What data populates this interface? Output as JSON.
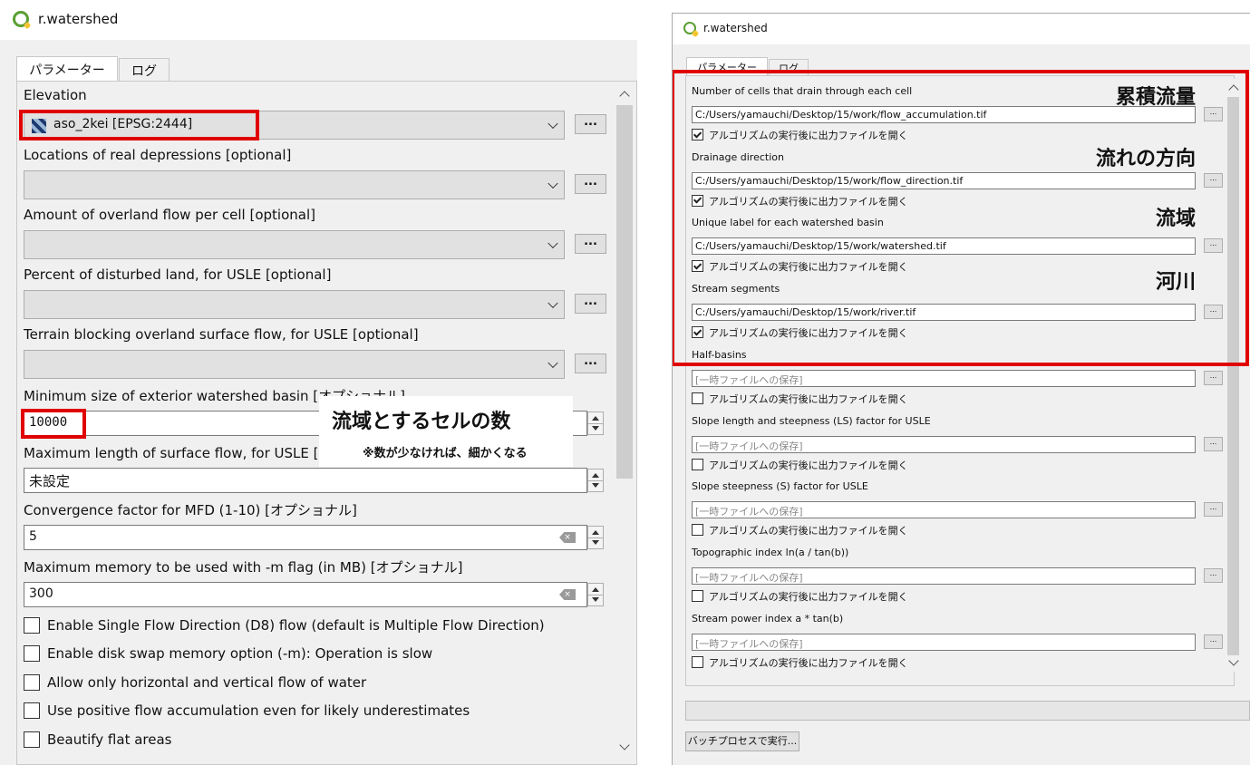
{
  "left": {
    "title": "r.watershed",
    "tabs": [
      "パラメーター",
      "ログ"
    ],
    "elevation_label": "Elevation",
    "elevation_value": "aso_2kei [EPSG:2444]",
    "depressions_label": "Locations of real depressions [optional]",
    "overland_label": "Amount of overland flow per cell [optional]",
    "disturbed_label": "Percent of disturbed land, for USLE [optional]",
    "blocking_label": "Terrain blocking overland surface flow, for USLE [optional]",
    "min_size_label": "Minimum size of exterior watershed basin [オプショナル]",
    "min_size_value": "10000",
    "max_length_label": "Maximum length of surface flow, for USLE [オプショ",
    "max_length_value": "未設定",
    "convergence_label": "Convergence factor for MFD (1-10) [オプショナル]",
    "convergence_value": "5",
    "memory_label": "Maximum memory to be used with -m flag (in MB) [オプショナル]",
    "memory_value": "300",
    "checkboxes": [
      "Enable Single Flow Direction (D8) flow (default is Multiple Flow Direction)",
      "Enable disk swap memory option (-m): Operation is slow",
      "Allow only horizontal and vertical flow of water",
      "Use positive flow accumulation even for likely underestimates",
      "Beautify flat areas"
    ],
    "ellipsis": "...",
    "annotation_title": "流域とするセルの数",
    "annotation_sub": "※数が少なければ、細かくなる"
  },
  "right": {
    "title": "r.watershed",
    "tabs": [
      "パラメーター",
      "ログ"
    ],
    "open_label": "アルゴリズムの実行後に出力ファイルを開く",
    "temp_placeholder": "[一時ファイルへの保存]",
    "ellipsis": "...",
    "outputs": [
      {
        "label": "Number of cells that drain through each cell",
        "value": "C:/Users/yamauchi/Desktop/15/work/flow_accumulation.tif",
        "checked": true,
        "note": "累積流量"
      },
      {
        "label": "Drainage direction",
        "value": "C:/Users/yamauchi/Desktop/15/work/flow_direction.tif",
        "checked": true,
        "note": "流れの方向"
      },
      {
        "label": "Unique label for each watershed basin",
        "value": "C:/Users/yamauchi/Desktop/15/work/watershed.tif",
        "checked": true,
        "note": "流域"
      },
      {
        "label": "Stream segments",
        "value": "C:/Users/yamauchi/Desktop/15/work/river.tif",
        "checked": true,
        "note": "河川"
      },
      {
        "label": "Half-basins",
        "value": "",
        "checked": false,
        "note": ""
      },
      {
        "label": "Slope length and steepness (LS) factor for USLE",
        "value": "",
        "checked": false,
        "note": ""
      },
      {
        "label": "Slope steepness (S) factor for USLE",
        "value": "",
        "checked": false,
        "note": ""
      },
      {
        "label": "Topographic index ln(a / tan(b))",
        "value": "",
        "checked": false,
        "note": ""
      },
      {
        "label": "Stream power index a * tan(b)",
        "value": "",
        "checked": false,
        "note": ""
      }
    ],
    "batch_button": "バッチプロセスで実行..."
  },
  "colors": {
    "highlight": "#e00000",
    "qgis_green": "#5a9e33"
  }
}
